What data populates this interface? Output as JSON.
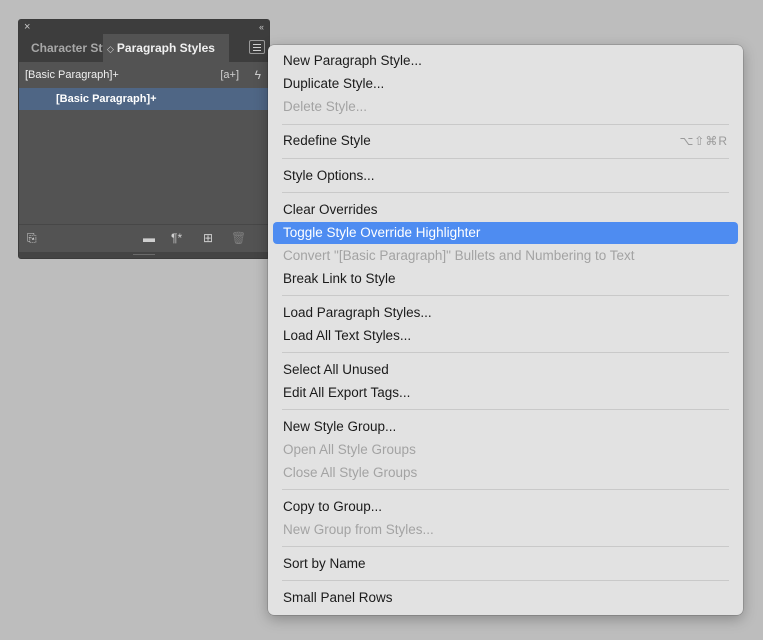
{
  "panel": {
    "close_glyph": "×",
    "collapse_glyph": "‹‹",
    "tabs": [
      {
        "label": "Character Styles"
      },
      {
        "label": "Paragraph Styles",
        "arrows": "◇"
      }
    ],
    "current_style": "[Basic Paragraph]+",
    "new_from_selection_glyph": "[a+]",
    "lightning_glyph": "ϟ",
    "list": [
      "[Basic Paragraph]+"
    ],
    "selection_color": "#4f6685",
    "bottom_icons": [
      {
        "name": "load-styles-icon",
        "glyph": "⎘"
      },
      {
        "name": "folder-icon",
        "glyph": "▬"
      },
      {
        "name": "clear-overrides-icon",
        "glyph": "¶*"
      },
      {
        "name": "new-style-icon",
        "glyph": "⊞"
      },
      {
        "name": "delete-icon",
        "glyph": "🗑"
      }
    ]
  },
  "menu": {
    "highlight_color": "#4e8cf1",
    "items": [
      {
        "label": "New Paragraph Style...",
        "disabled": false
      },
      {
        "label": "Duplicate Style...",
        "disabled": false
      },
      {
        "label": "Delete Style...",
        "disabled": true
      },
      {
        "label": "Redefine Style",
        "disabled": false,
        "shortcut": "⌥⇧⌘R"
      },
      {
        "label": "Style Options...",
        "disabled": false
      },
      {
        "label": "Clear Overrides",
        "disabled": false
      },
      {
        "label": "Toggle Style Override Highlighter",
        "disabled": false,
        "highlighted": true
      },
      {
        "label": "Convert \"[Basic Paragraph]\" Bullets and Numbering to Text",
        "disabled": true
      },
      {
        "label": "Break Link to Style",
        "disabled": false
      },
      {
        "label": "Load Paragraph Styles...",
        "disabled": false
      },
      {
        "label": "Load All Text Styles...",
        "disabled": false
      },
      {
        "label": "Select All Unused",
        "disabled": false
      },
      {
        "label": "Edit All Export Tags...",
        "disabled": false
      },
      {
        "label": "New Style Group...",
        "disabled": false
      },
      {
        "label": "Open All Style Groups",
        "disabled": true
      },
      {
        "label": "Close All Style Groups",
        "disabled": true
      },
      {
        "label": "Copy to Group...",
        "disabled": false
      },
      {
        "label": "New Group from Styles...",
        "disabled": true
      },
      {
        "label": "Sort by Name",
        "disabled": false
      },
      {
        "label": "Small Panel Rows",
        "disabled": false
      }
    ]
  }
}
